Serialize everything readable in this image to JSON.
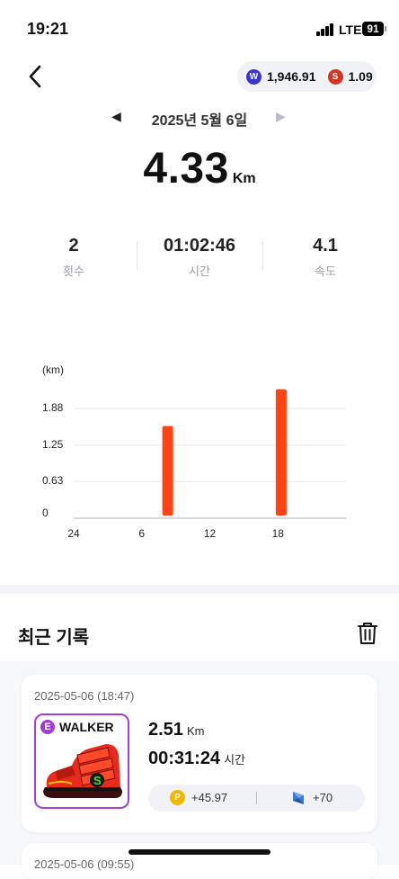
{
  "status_bar": {
    "time": "19:21",
    "network": "LTE",
    "battery": "91"
  },
  "header": {
    "balances": [
      {
        "icon": "w-token-icon",
        "value": "1,946.91"
      },
      {
        "icon": "s-token-icon",
        "value": "1.09"
      }
    ]
  },
  "date_nav": {
    "date": "2025년 5월 6일"
  },
  "summary": {
    "distance": "4.33",
    "distance_unit": "Km",
    "stats": [
      {
        "value": "2",
        "label": "횟수"
      },
      {
        "value": "01:02:46",
        "label": "시간"
      },
      {
        "value": "4.1",
        "label": "속도"
      }
    ]
  },
  "chart_data": {
    "type": "bar",
    "ylabel": "(km)",
    "yticks": [
      "1.88",
      "1.25",
      "0.63",
      "0"
    ],
    "xticks": [
      "24",
      "6",
      "12",
      "18"
    ],
    "ylim": [
      0,
      2.2
    ],
    "x": [
      9,
      19
    ],
    "values": [
      1.58,
      2.21
    ],
    "grid": true,
    "colors": {
      "bar": "#ff4313"
    }
  },
  "history": {
    "title": "최근 기록",
    "records": [
      {
        "date": "2025-05-06 (18:47)",
        "grade": "E",
        "shoe_type": "WALKER",
        "distance": "2.51",
        "distance_unit": "Km",
        "time": "00:31:24",
        "time_unit": "시간",
        "reward_points": "+45.97",
        "reward_gems": "+70"
      },
      {
        "date": "2025-05-06 (09:55)"
      }
    ]
  }
}
